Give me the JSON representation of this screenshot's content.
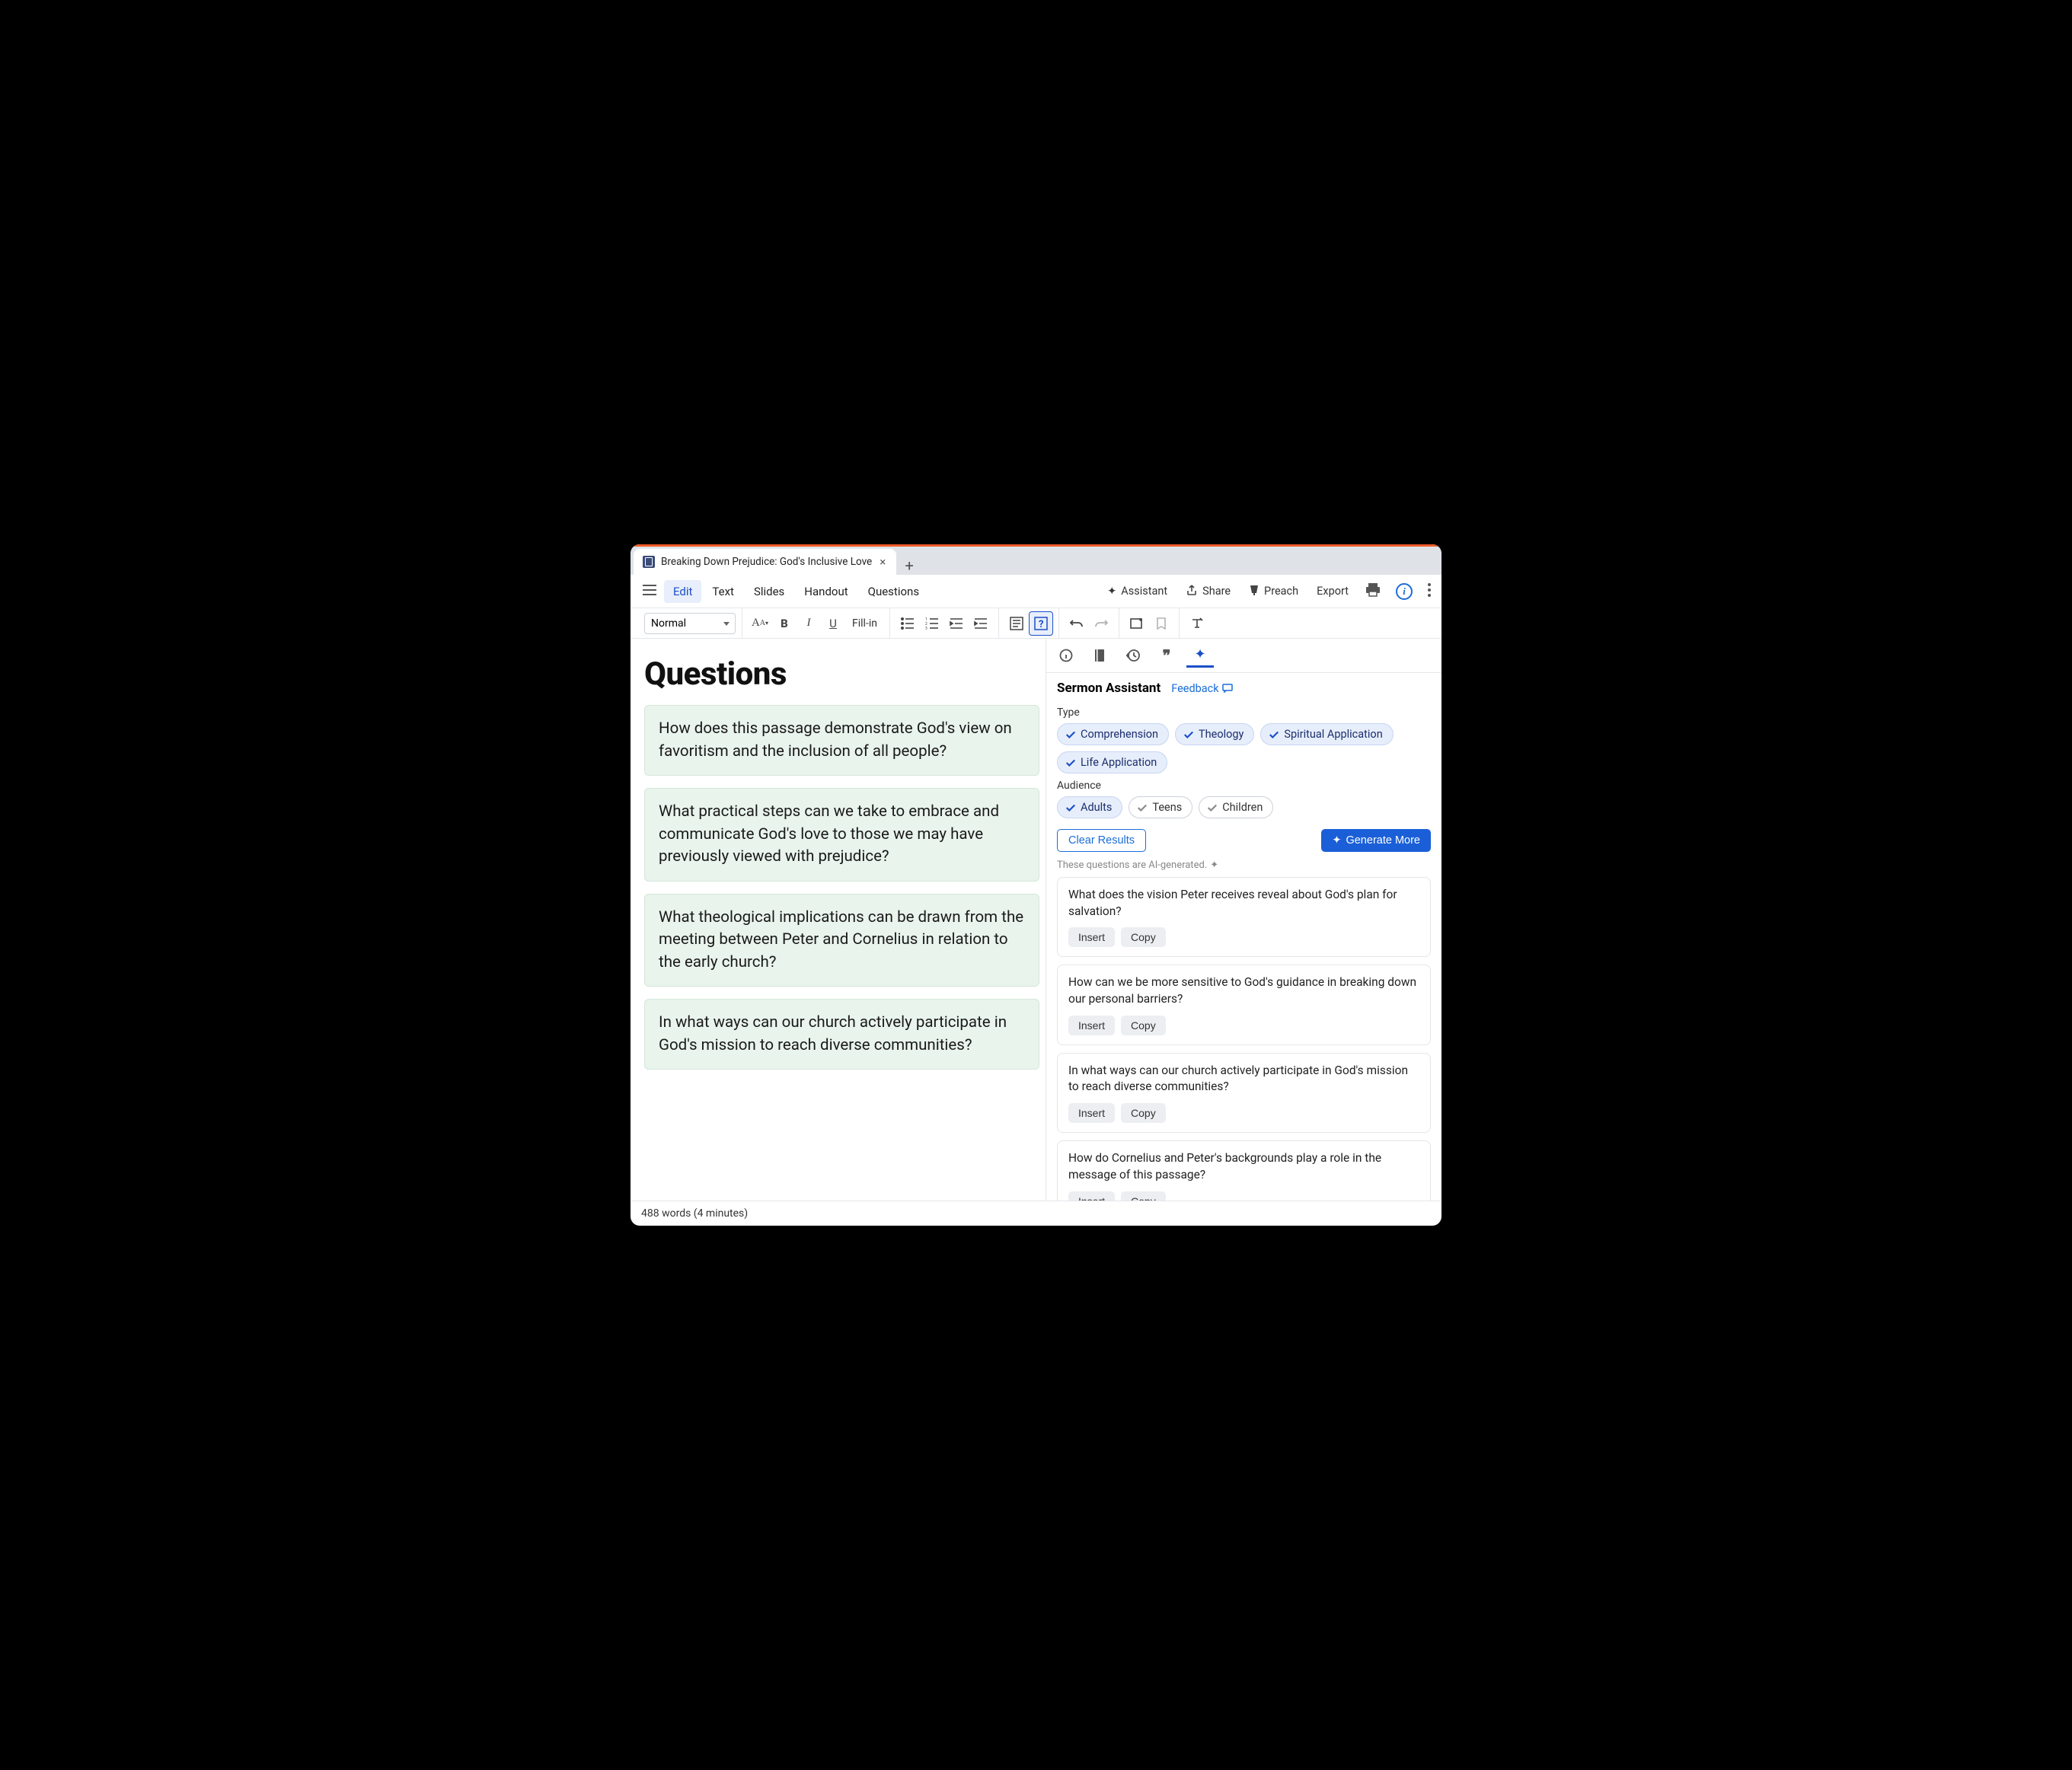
{
  "tab": {
    "title": "Breaking Down Prejudice: God's Inclusive Love"
  },
  "menu": {
    "views": [
      "Edit",
      "Text",
      "Slides",
      "Handout",
      "Questions"
    ],
    "active_view": "Edit",
    "assistant": "Assistant",
    "share": "Share",
    "preach": "Preach",
    "export": "Export"
  },
  "toolbar": {
    "style": "Normal",
    "fillin": "Fill-in"
  },
  "document": {
    "heading": "Questions",
    "questions": [
      "How does this passage demonstrate God's view on favoritism and the inclusion of all people?",
      "What practical steps can we take to embrace and communicate God's love to those we may have previously viewed with prejudice?",
      "What theological implications can be drawn from the meeting between Peter and Cornelius in relation to the early church?",
      "In what ways can our church actively participate in God's mission to reach diverse communities?"
    ]
  },
  "assistant": {
    "title": "Sermon Assistant",
    "feedback": "Feedback",
    "type_label": "Type",
    "types": [
      {
        "label": "Comprehension",
        "selected": true
      },
      {
        "label": "Theology",
        "selected": true
      },
      {
        "label": "Spiritual Application",
        "selected": true
      },
      {
        "label": "Life Application",
        "selected": true
      }
    ],
    "audience_label": "Audience",
    "audiences": [
      {
        "label": "Adults",
        "selected": true
      },
      {
        "label": "Teens",
        "selected": false
      },
      {
        "label": "Children",
        "selected": false
      }
    ],
    "clear": "Clear Results",
    "generate": "Generate More",
    "ai_note": "These questions are AI-generated.",
    "insert": "Insert",
    "copy": "Copy",
    "generated": [
      "What does the vision Peter receives reveal about God's plan for salvation?",
      "How can we be more sensitive to God's guidance in breaking down our personal barriers?",
      "In what ways can our church actively participate in God's mission to reach diverse communities?",
      "How do Cornelius and Peter's backgrounds play a role in the message of this passage?"
    ]
  },
  "status": {
    "text": "488 words (4 minutes)"
  }
}
